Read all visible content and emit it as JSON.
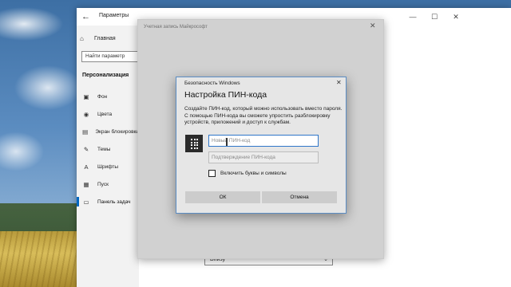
{
  "settings_window": {
    "title": "Параметры",
    "nav_home": "Главная",
    "search_placeholder": "Найти параметр",
    "section_title": "Персонализация",
    "nav_items": [
      {
        "label": "Фон",
        "icon": "image-icon"
      },
      {
        "label": "Цвета",
        "icon": "palette-icon"
      },
      {
        "label": "Экран блокировки",
        "icon": "lock-screen-icon"
      },
      {
        "label": "Темы",
        "icon": "brush-icon"
      },
      {
        "label": "Шрифты",
        "icon": "font-icon"
      },
      {
        "label": "Пуск",
        "icon": "start-icon"
      },
      {
        "label": "Панель задач",
        "icon": "taskbar-icon"
      }
    ],
    "active_item": "Панель задач",
    "dropdown_value": "Внизу"
  },
  "account_window": {
    "title": "Учетная запись Майкрософт"
  },
  "security_dialog": {
    "caption": "Безопасность Windows",
    "heading": "Настройка ПИН-кода",
    "description": "Создайте ПИН-код, который можно использовать вместо пароля. С помощью ПИН-кода вы сможете упростить разблокировку устройств, приложений и доступ к службам.",
    "new_pin_placeholder": "Новый ПИН-код",
    "confirm_pin_placeholder": "Подтверждение ПИН-кода",
    "checkbox_label": "Включить буквы и символы",
    "checkbox_checked": false,
    "ok_label": "ОК",
    "cancel_label": "Отмена"
  },
  "colors": {
    "accent": "#0067c0",
    "dialog_border": "#5b8dc4",
    "pin_tile": "#2b2b2b"
  }
}
